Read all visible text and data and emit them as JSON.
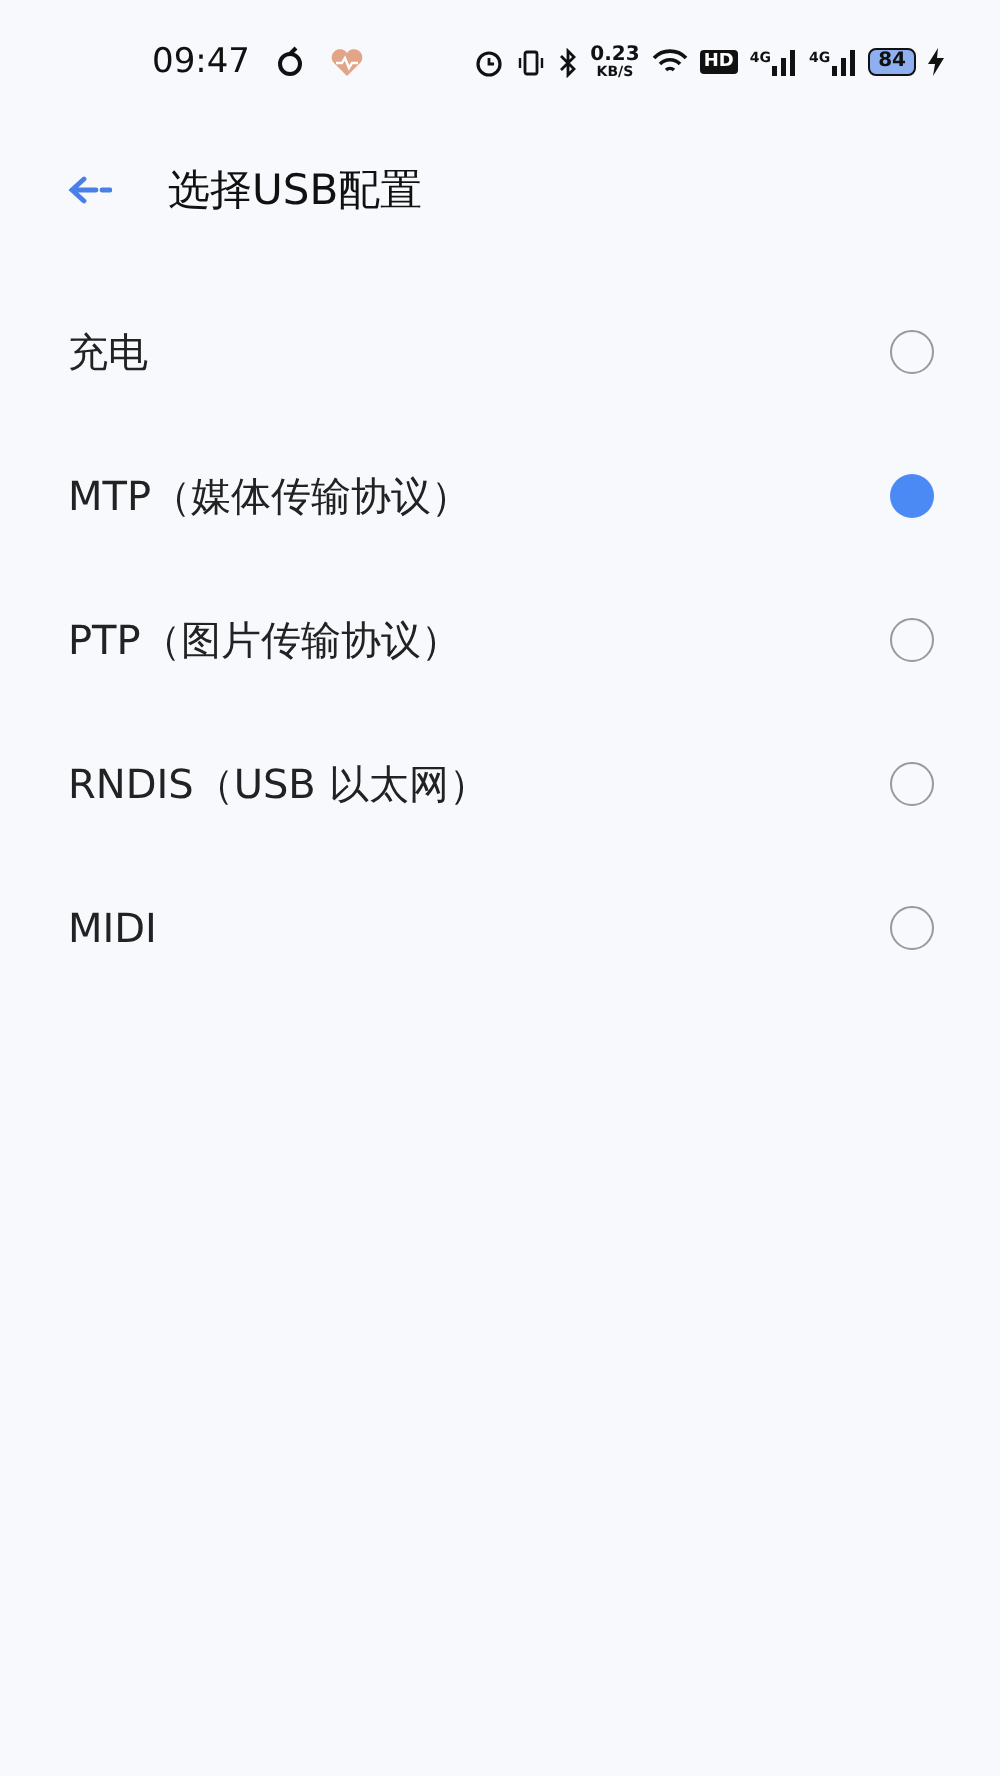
{
  "status_bar": {
    "time": "09:47",
    "net_speed": "0.23",
    "net_unit": "KB/S",
    "hd": "HD",
    "signal_labels": [
      "4G",
      "4G"
    ],
    "battery": "84"
  },
  "header": {
    "title": "选择USB配置"
  },
  "options": [
    {
      "label": "充电",
      "selected": false
    },
    {
      "label": "MTP（媒体传输协议）",
      "selected": true
    },
    {
      "label": "PTP（图片传输协议）",
      "selected": false
    },
    {
      "label": "RNDIS（USB 以太网）",
      "selected": false
    },
    {
      "label": "MIDI",
      "selected": false
    }
  ]
}
